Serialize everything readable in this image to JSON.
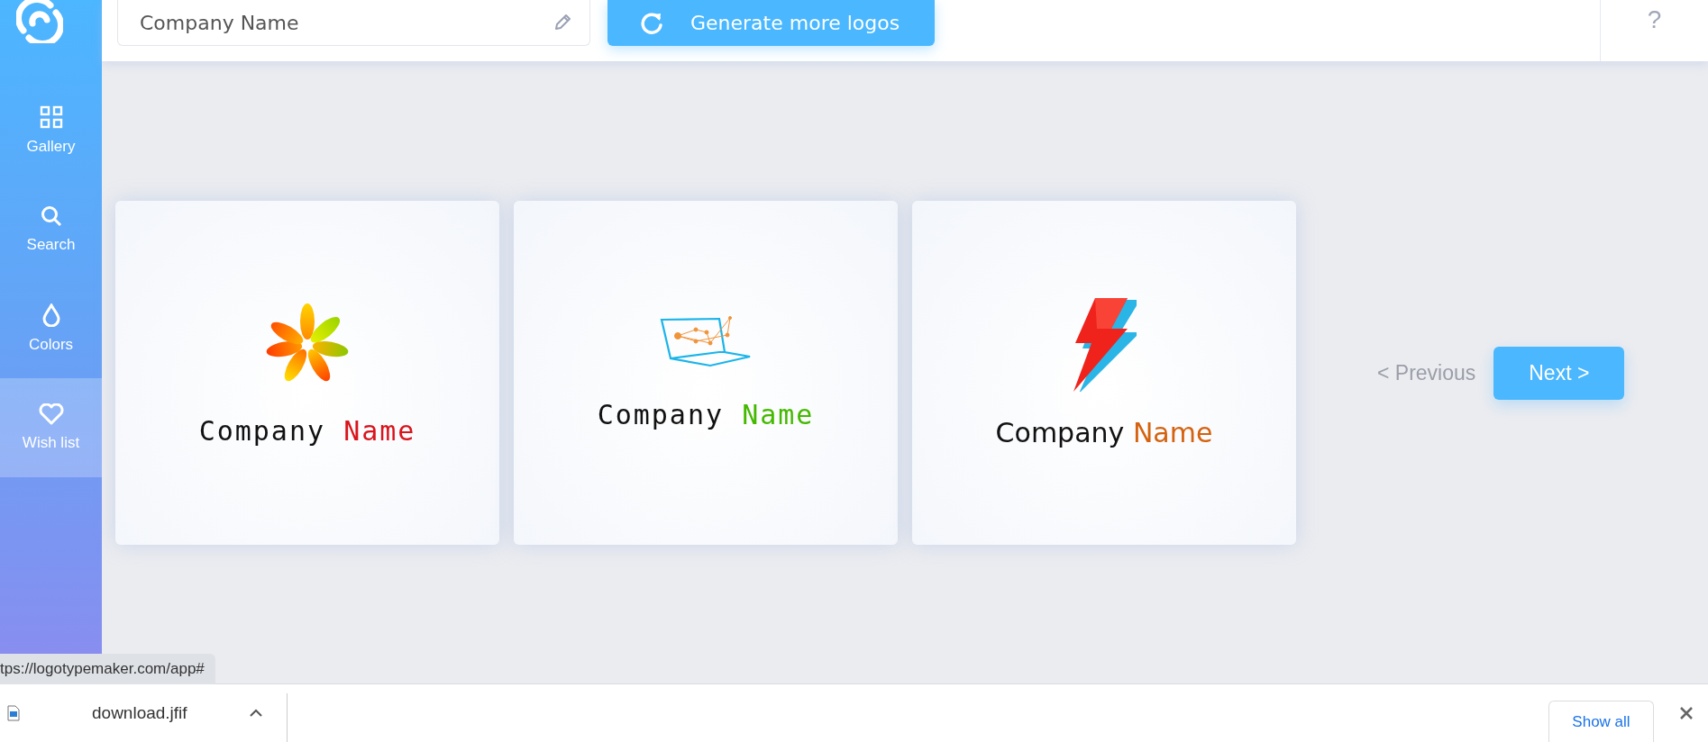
{
  "header": {
    "company_field": {
      "value": "Company Name"
    },
    "generate_button": "Generate more logos",
    "help": "?"
  },
  "sidebar": {
    "items": [
      {
        "kind": "gallery",
        "label": "Gallery",
        "selected": false
      },
      {
        "kind": "search",
        "label": "Search",
        "selected": false
      },
      {
        "kind": "colors",
        "label": "Colors",
        "selected": false
      },
      {
        "kind": "wishlist",
        "label": "Wish list",
        "selected": true
      }
    ]
  },
  "cards": [
    {
      "kind": "flower",
      "first": "Company",
      "second": "Name",
      "color": "#d9141c"
    },
    {
      "kind": "laptop",
      "first": "Company",
      "second": "Name",
      "color": "#45b900"
    },
    {
      "kind": "bolt",
      "first": "Company",
      "second": "Name",
      "color": "#d4620f"
    }
  ],
  "pager": {
    "previous": "< Previous",
    "next": "Next >"
  },
  "status_url": "tps://logotypemaker.com/app#",
  "download_bar": {
    "file": "download.jfif",
    "show_all": "Show all"
  }
}
